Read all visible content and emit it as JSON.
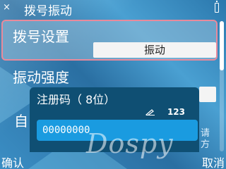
{
  "title_bar": {
    "close_glyph": "×",
    "title": "拨号振动",
    "battery_icon": "battery-icon"
  },
  "settings": {
    "dial": {
      "label": "拨号设置",
      "value": "振动"
    },
    "strength": {
      "label": "振动强度"
    },
    "auto": {
      "label_partial": "自"
    },
    "right_partial_text": "请\n方"
  },
  "dialog": {
    "title": "注册码（ 8位）",
    "input_mode": "123",
    "input_value": "00000000"
  },
  "watermark": "Dospy",
  "softkeys": {
    "left": "确认",
    "right": "取消"
  },
  "colors": {
    "highlight_border": "#e88a9c",
    "dialog_bg": "#0f4f73",
    "input_bg": "#1a9be0"
  }
}
